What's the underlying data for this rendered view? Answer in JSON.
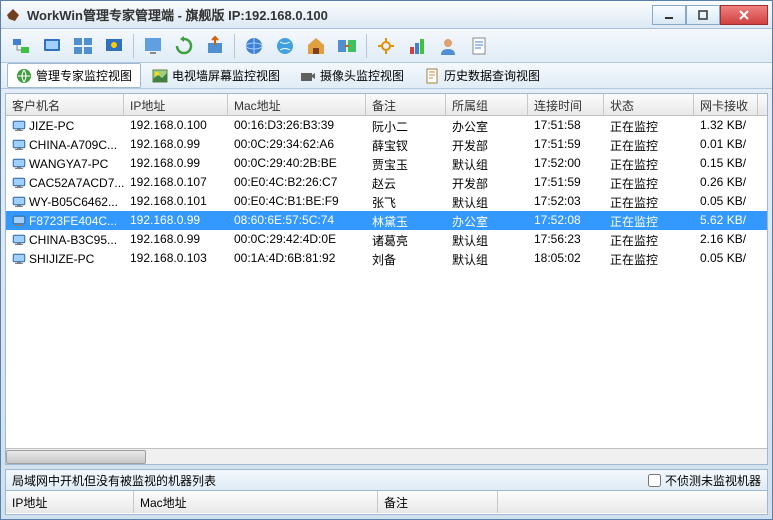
{
  "title": "WorkWin管理专家管理端 - 旗舰版 IP:192.168.0.100",
  "tabs": {
    "t1": "管理专家监控视图",
    "t2": "电视墙屏幕监控视图",
    "t3": "摄像头监控视图",
    "t4": "历史数据查询视图"
  },
  "columns": {
    "name": "客户机名",
    "ip": "IP地址",
    "mac": "Mac地址",
    "note": "备注",
    "group": "所属组",
    "time": "连接时间",
    "status": "状态",
    "nic": "网卡接收"
  },
  "rows": [
    {
      "name": "JIZE-PC",
      "ip": "192.168.0.100",
      "mac": "00:16:D3:26:B3:39",
      "note": "阮小二",
      "group": "办公室",
      "time": "17:51:58",
      "status": "正在监控",
      "nic": "1.32 KB/"
    },
    {
      "name": "CHINA-A709C...",
      "ip": "192.168.0.99",
      "mac": "00:0C:29:34:62:A6",
      "note": "薛宝钗",
      "group": "开发部",
      "time": "17:51:59",
      "status": "正在监控",
      "nic": "0.01 KB/"
    },
    {
      "name": "WANGYA7-PC",
      "ip": "192.168.0.99",
      "mac": "00:0C:29:40:2B:BE",
      "note": "贾宝玉",
      "group": "默认组",
      "time": "17:52:00",
      "status": "正在监控",
      "nic": "0.15 KB/"
    },
    {
      "name": "CAC52A7ACD7...",
      "ip": "192.168.0.107",
      "mac": "00:E0:4C:B2:26:C7",
      "note": "赵云",
      "group": "开发部",
      "time": "17:51:59",
      "status": "正在监控",
      "nic": "0.26 KB/"
    },
    {
      "name": "WY-B05C6462...",
      "ip": "192.168.0.101",
      "mac": "00:E0:4C:B1:BE:F9",
      "note": "张飞",
      "group": "默认组",
      "time": "17:52:03",
      "status": "正在监控",
      "nic": "0.05 KB/"
    },
    {
      "name": "F8723FE404C...",
      "ip": "192.168.0.99",
      "mac": "08:60:6E:57:5C:74",
      "note": "林黛玉",
      "group": "办公室",
      "time": "17:52:08",
      "status": "正在监控",
      "nic": "5.62 KB/",
      "selected": true
    },
    {
      "name": "CHINA-B3C95...",
      "ip": "192.168.0.99",
      "mac": "00:0C:29:42:4D:0E",
      "note": "诸葛亮",
      "group": "默认组",
      "time": "17:56:23",
      "status": "正在监控",
      "nic": "2.16 KB/"
    },
    {
      "name": "SHIJIZE-PC",
      "ip": "192.168.0.103",
      "mac": "00:1A:4D:6B:81:92",
      "note": "刘备",
      "group": "默认组",
      "time": "18:05:02",
      "status": "正在监控",
      "nic": "0.05 KB/"
    }
  ],
  "bottom": {
    "title": "局域网中开机但没有被监视的机器列表",
    "checkbox": "不侦测未监视机器",
    "cols": {
      "ip": "IP地址",
      "mac": "Mac地址",
      "note": "备注"
    }
  }
}
